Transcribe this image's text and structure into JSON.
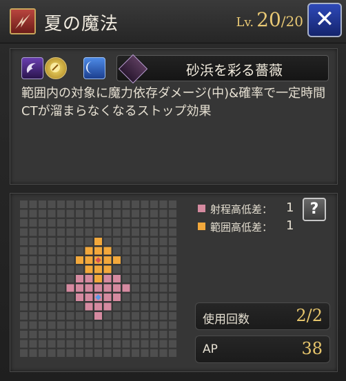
{
  "header": {
    "skill_type_icon": "spell-skill-icon",
    "skill_name": "夏の魔法",
    "level_label": "Lv.",
    "level_current": "20",
    "level_separator": "/",
    "level_max": "20",
    "close_icon": "close-x-icon",
    "close_glyph": "✕"
  },
  "elements": {
    "icons": [
      "wind-element-icon",
      "sun-element-icon",
      "moon-element-icon"
    ]
  },
  "equipment": {
    "icon": "rose-emblem-icon",
    "name": "砂浜を彩る薔薇"
  },
  "description": {
    "text": "範囲内の対象に魔力依存ダメージ(中)&確率で一定時間CTが溜まらなくなるストップ効果"
  },
  "range": {
    "legend": [
      {
        "label": "射程高低差：",
        "value": "1",
        "color": "#d58aa0"
      },
      {
        "label": "範囲高低差：",
        "value": "1",
        "color": "#f2a83c"
      }
    ],
    "help_glyph": "?",
    "colors": {
      "empty": "#4e4e4e",
      "range": "#d58aa0",
      "effect": "#f2a83c",
      "center": "#d85050",
      "caster": "#5b9ae6"
    }
  },
  "stats": {
    "uses_label": "使用回数",
    "uses_value": "2/2",
    "ap_label": "AP",
    "ap_value": "38"
  }
}
